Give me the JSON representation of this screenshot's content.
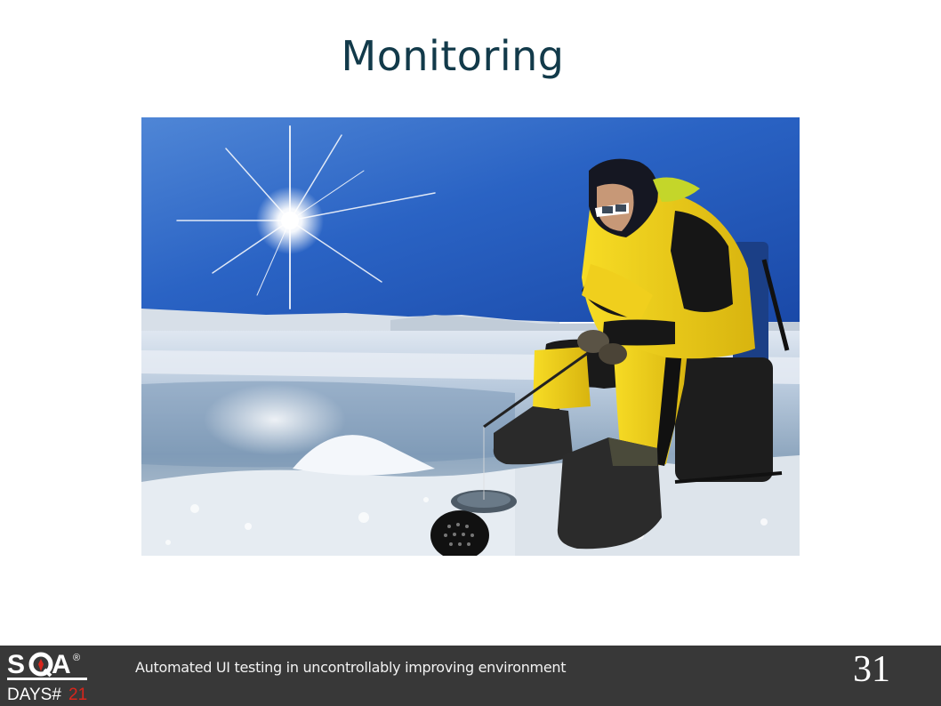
{
  "slide": {
    "title": "Monitoring",
    "page_number": "31"
  },
  "footer": {
    "text": "Automated UI testing in uncontrollably improving environment",
    "logo": {
      "brand": "SQA",
      "registered": "®",
      "event_prefix": "DAYS#",
      "event_number": "21"
    }
  },
  "colors": {
    "title": "#123a4a",
    "footer_bg": "#383838",
    "logo_accent": "#d9261c",
    "sky": "#1f5fc2",
    "suit": "#f3d21a"
  }
}
